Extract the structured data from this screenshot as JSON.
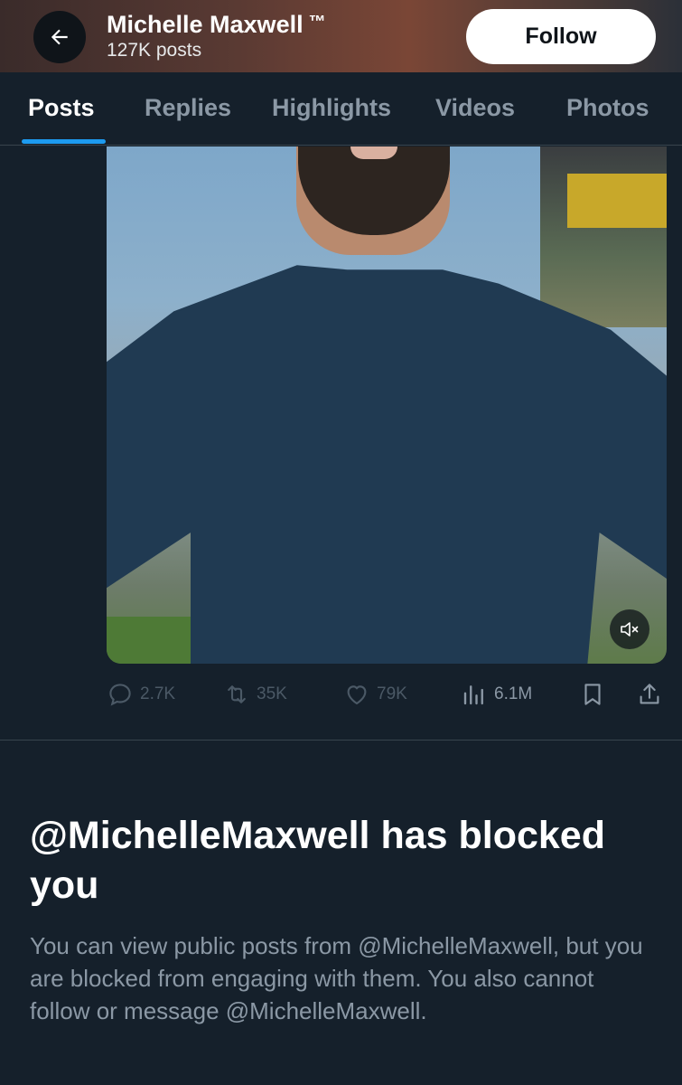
{
  "header": {
    "profile_name": "Michelle Maxwell",
    "trademark": "™",
    "post_count": "127K posts",
    "follow_label": "Follow"
  },
  "tabs": [
    {
      "label": "Posts",
      "active": true
    },
    {
      "label": "Replies",
      "active": false
    },
    {
      "label": "Highlights",
      "active": false
    },
    {
      "label": "Videos",
      "active": false
    },
    {
      "label": "Photos",
      "active": false
    }
  ],
  "post": {
    "media_type": "video",
    "muted": true,
    "stats": {
      "replies": "2.7K",
      "reposts": "35K",
      "likes": "79K",
      "views": "6.1M"
    }
  },
  "blocked": {
    "title": "@MichelleMaxwell has blocked you",
    "message": "You can view public posts from @MichelleMaxwell, but you are blocked from engaging with them. You also cannot follow or message @MichelleMaxwell."
  },
  "colors": {
    "background": "#15202b",
    "accent": "#1d9bf0",
    "text_primary": "#ffffff",
    "text_secondary": "#8b98a5",
    "divider": "#38444d"
  },
  "icons": [
    "back-arrow-icon",
    "mute-icon",
    "reply-icon",
    "repost-icon",
    "like-icon",
    "views-icon",
    "bookmark-icon",
    "share-icon"
  ]
}
